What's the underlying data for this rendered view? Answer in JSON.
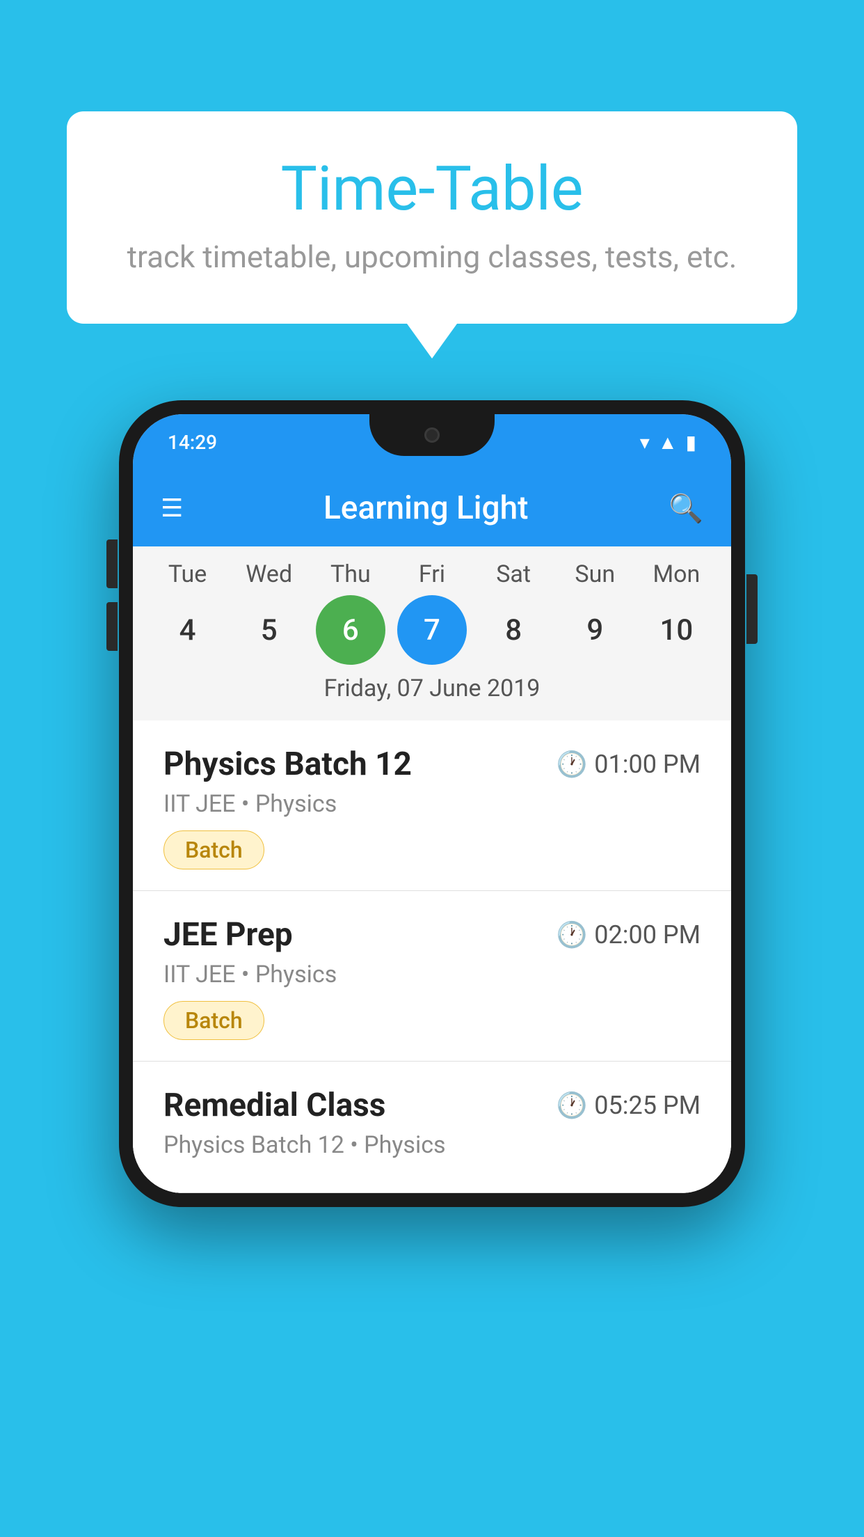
{
  "background_color": "#29BFEA",
  "speech_bubble": {
    "title": "Time-Table",
    "subtitle": "track timetable, upcoming classes, tests, etc."
  },
  "phone": {
    "status_bar": {
      "time": "14:29",
      "icons": [
        "wifi",
        "signal",
        "battery"
      ]
    },
    "app_bar": {
      "title": "Learning Light",
      "menu_icon": "☰",
      "search_icon": "🔍"
    },
    "calendar": {
      "days": [
        "Tue",
        "Wed",
        "Thu",
        "Fri",
        "Sat",
        "Sun",
        "Mon"
      ],
      "dates": [
        "4",
        "5",
        "6",
        "7",
        "8",
        "9",
        "10"
      ],
      "today_index": 2,
      "selected_index": 3,
      "selected_label": "Friday, 07 June 2019"
    },
    "classes": [
      {
        "name": "Physics Batch 12",
        "time": "01:00 PM",
        "meta": "IIT JEE • Physics",
        "badge": "Batch"
      },
      {
        "name": "JEE Prep",
        "time": "02:00 PM",
        "meta": "IIT JEE • Physics",
        "badge": "Batch"
      },
      {
        "name": "Remedial Class",
        "time": "05:25 PM",
        "meta": "Physics Batch 12 • Physics",
        "badge": ""
      }
    ]
  }
}
